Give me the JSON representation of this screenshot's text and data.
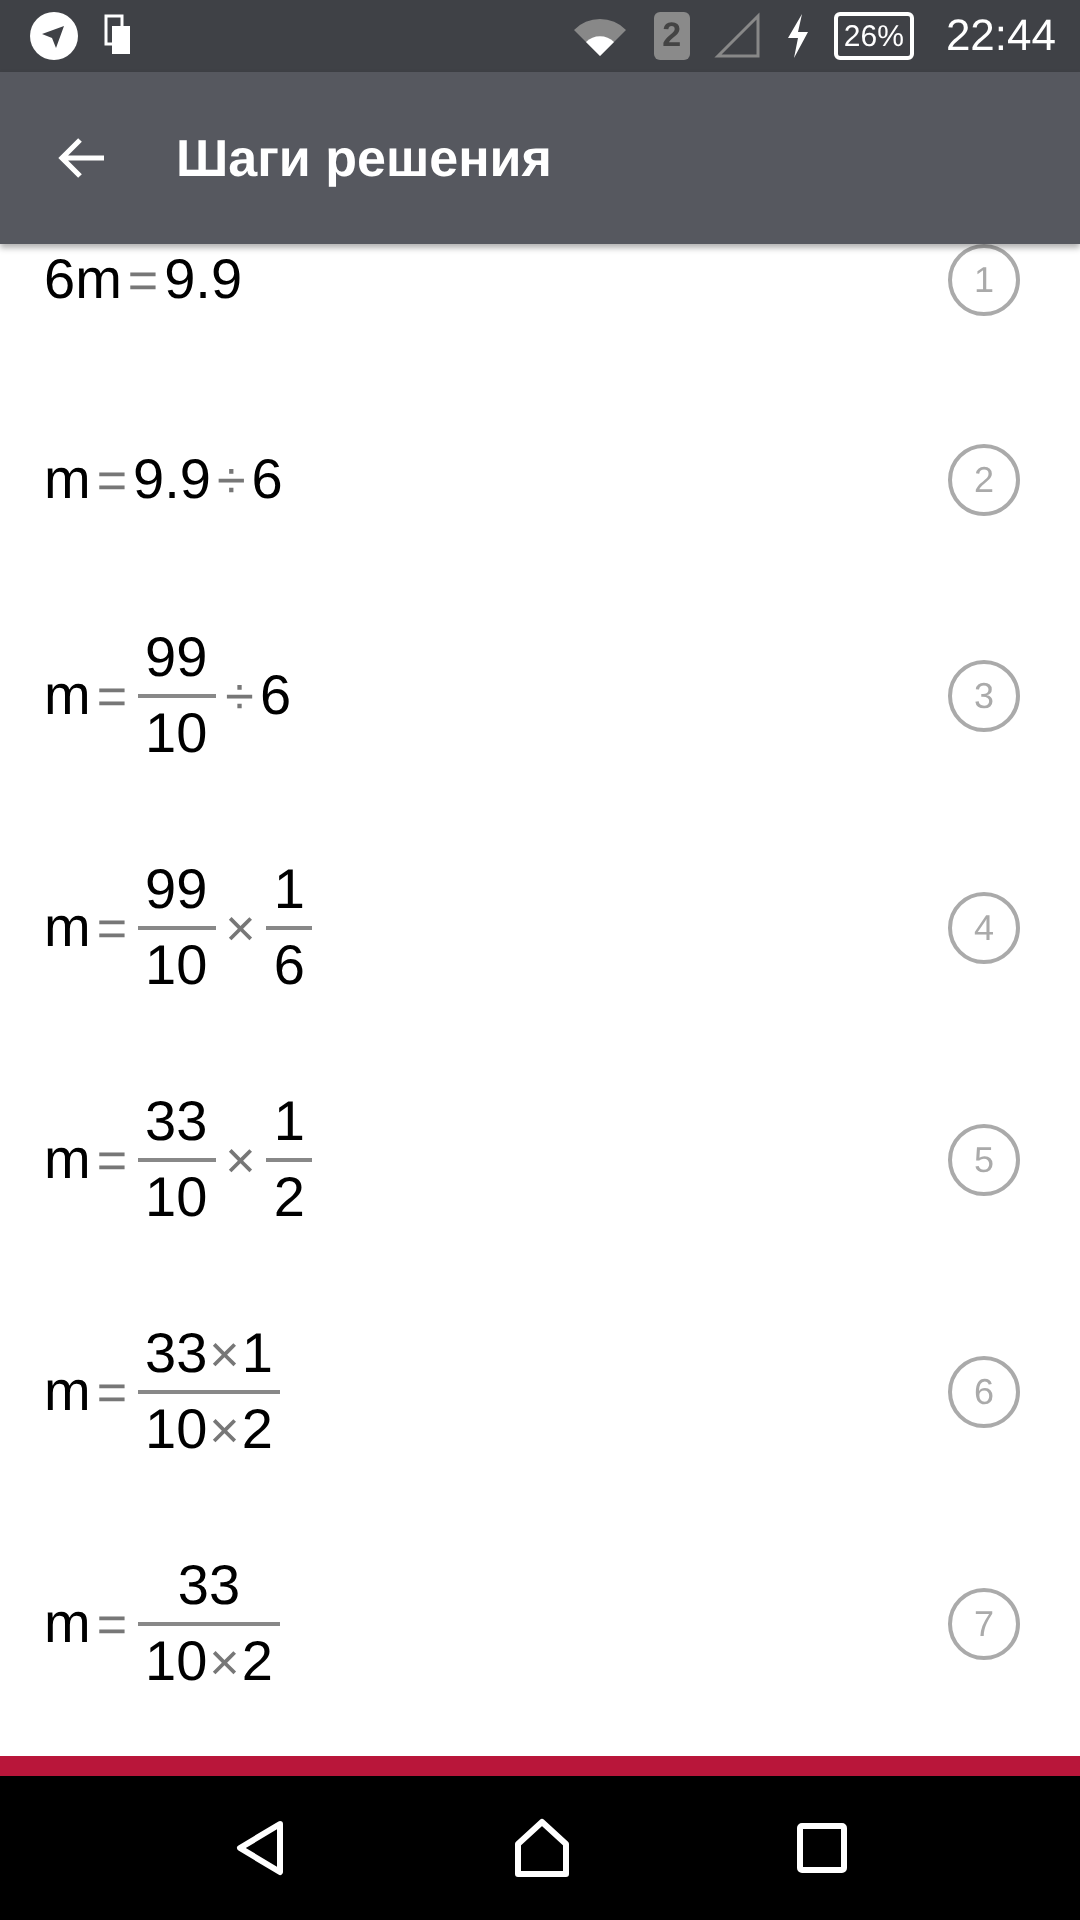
{
  "status_bar": {
    "sim": "2",
    "battery": "26%",
    "time": "22:44"
  },
  "app_bar": {
    "title": "Шаги решения"
  },
  "steps": [
    {
      "number": "1",
      "tokens": [
        {
          "kind": "text",
          "value": "6m"
        },
        {
          "kind": "op",
          "value": "="
        },
        {
          "kind": "text",
          "value": "9.9"
        }
      ]
    },
    {
      "number": "2",
      "tokens": [
        {
          "kind": "text",
          "value": "m"
        },
        {
          "kind": "op",
          "value": "="
        },
        {
          "kind": "text",
          "value": "9.9"
        },
        {
          "kind": "op",
          "value": "÷"
        },
        {
          "kind": "text",
          "value": "6"
        }
      ]
    },
    {
      "number": "3",
      "tokens": [
        {
          "kind": "text",
          "value": "m"
        },
        {
          "kind": "op",
          "value": "="
        },
        {
          "kind": "frac",
          "num": [
            {
              "kind": "text",
              "value": "99"
            }
          ],
          "den": [
            {
              "kind": "text",
              "value": "10"
            }
          ]
        },
        {
          "kind": "op",
          "value": "÷"
        },
        {
          "kind": "text",
          "value": "6"
        }
      ]
    },
    {
      "number": "4",
      "tokens": [
        {
          "kind": "text",
          "value": "m"
        },
        {
          "kind": "op",
          "value": "="
        },
        {
          "kind": "frac",
          "num": [
            {
              "kind": "text",
              "value": "99"
            }
          ],
          "den": [
            {
              "kind": "text",
              "value": "10"
            }
          ]
        },
        {
          "kind": "op",
          "value": "×"
        },
        {
          "kind": "frac",
          "num": [
            {
              "kind": "text",
              "value": "1"
            }
          ],
          "den": [
            {
              "kind": "text",
              "value": "6"
            }
          ]
        }
      ]
    },
    {
      "number": "5",
      "tokens": [
        {
          "kind": "text",
          "value": "m"
        },
        {
          "kind": "op",
          "value": "="
        },
        {
          "kind": "frac",
          "num": [
            {
              "kind": "text",
              "value": "33"
            }
          ],
          "den": [
            {
              "kind": "text",
              "value": "10"
            }
          ]
        },
        {
          "kind": "op",
          "value": "×"
        },
        {
          "kind": "frac",
          "num": [
            {
              "kind": "text",
              "value": "1"
            }
          ],
          "den": [
            {
              "kind": "text",
              "value": "2"
            }
          ]
        }
      ]
    },
    {
      "number": "6",
      "tokens": [
        {
          "kind": "text",
          "value": "m"
        },
        {
          "kind": "op",
          "value": "="
        },
        {
          "kind": "frac",
          "num": [
            {
              "kind": "text",
              "value": "33"
            },
            {
              "kind": "op",
              "value": "×"
            },
            {
              "kind": "text",
              "value": "1"
            }
          ],
          "den": [
            {
              "kind": "text",
              "value": "10"
            },
            {
              "kind": "op",
              "value": "×"
            },
            {
              "kind": "text",
              "value": "2"
            }
          ]
        }
      ]
    },
    {
      "number": "7",
      "tokens": [
        {
          "kind": "text",
          "value": "m"
        },
        {
          "kind": "op",
          "value": "="
        },
        {
          "kind": "frac",
          "num": [
            {
              "kind": "text",
              "value": "33"
            }
          ],
          "den": [
            {
              "kind": "text",
              "value": "10"
            },
            {
              "kind": "op",
              "value": "×"
            },
            {
              "kind": "text",
              "value": "2"
            }
          ]
        }
      ]
    }
  ]
}
